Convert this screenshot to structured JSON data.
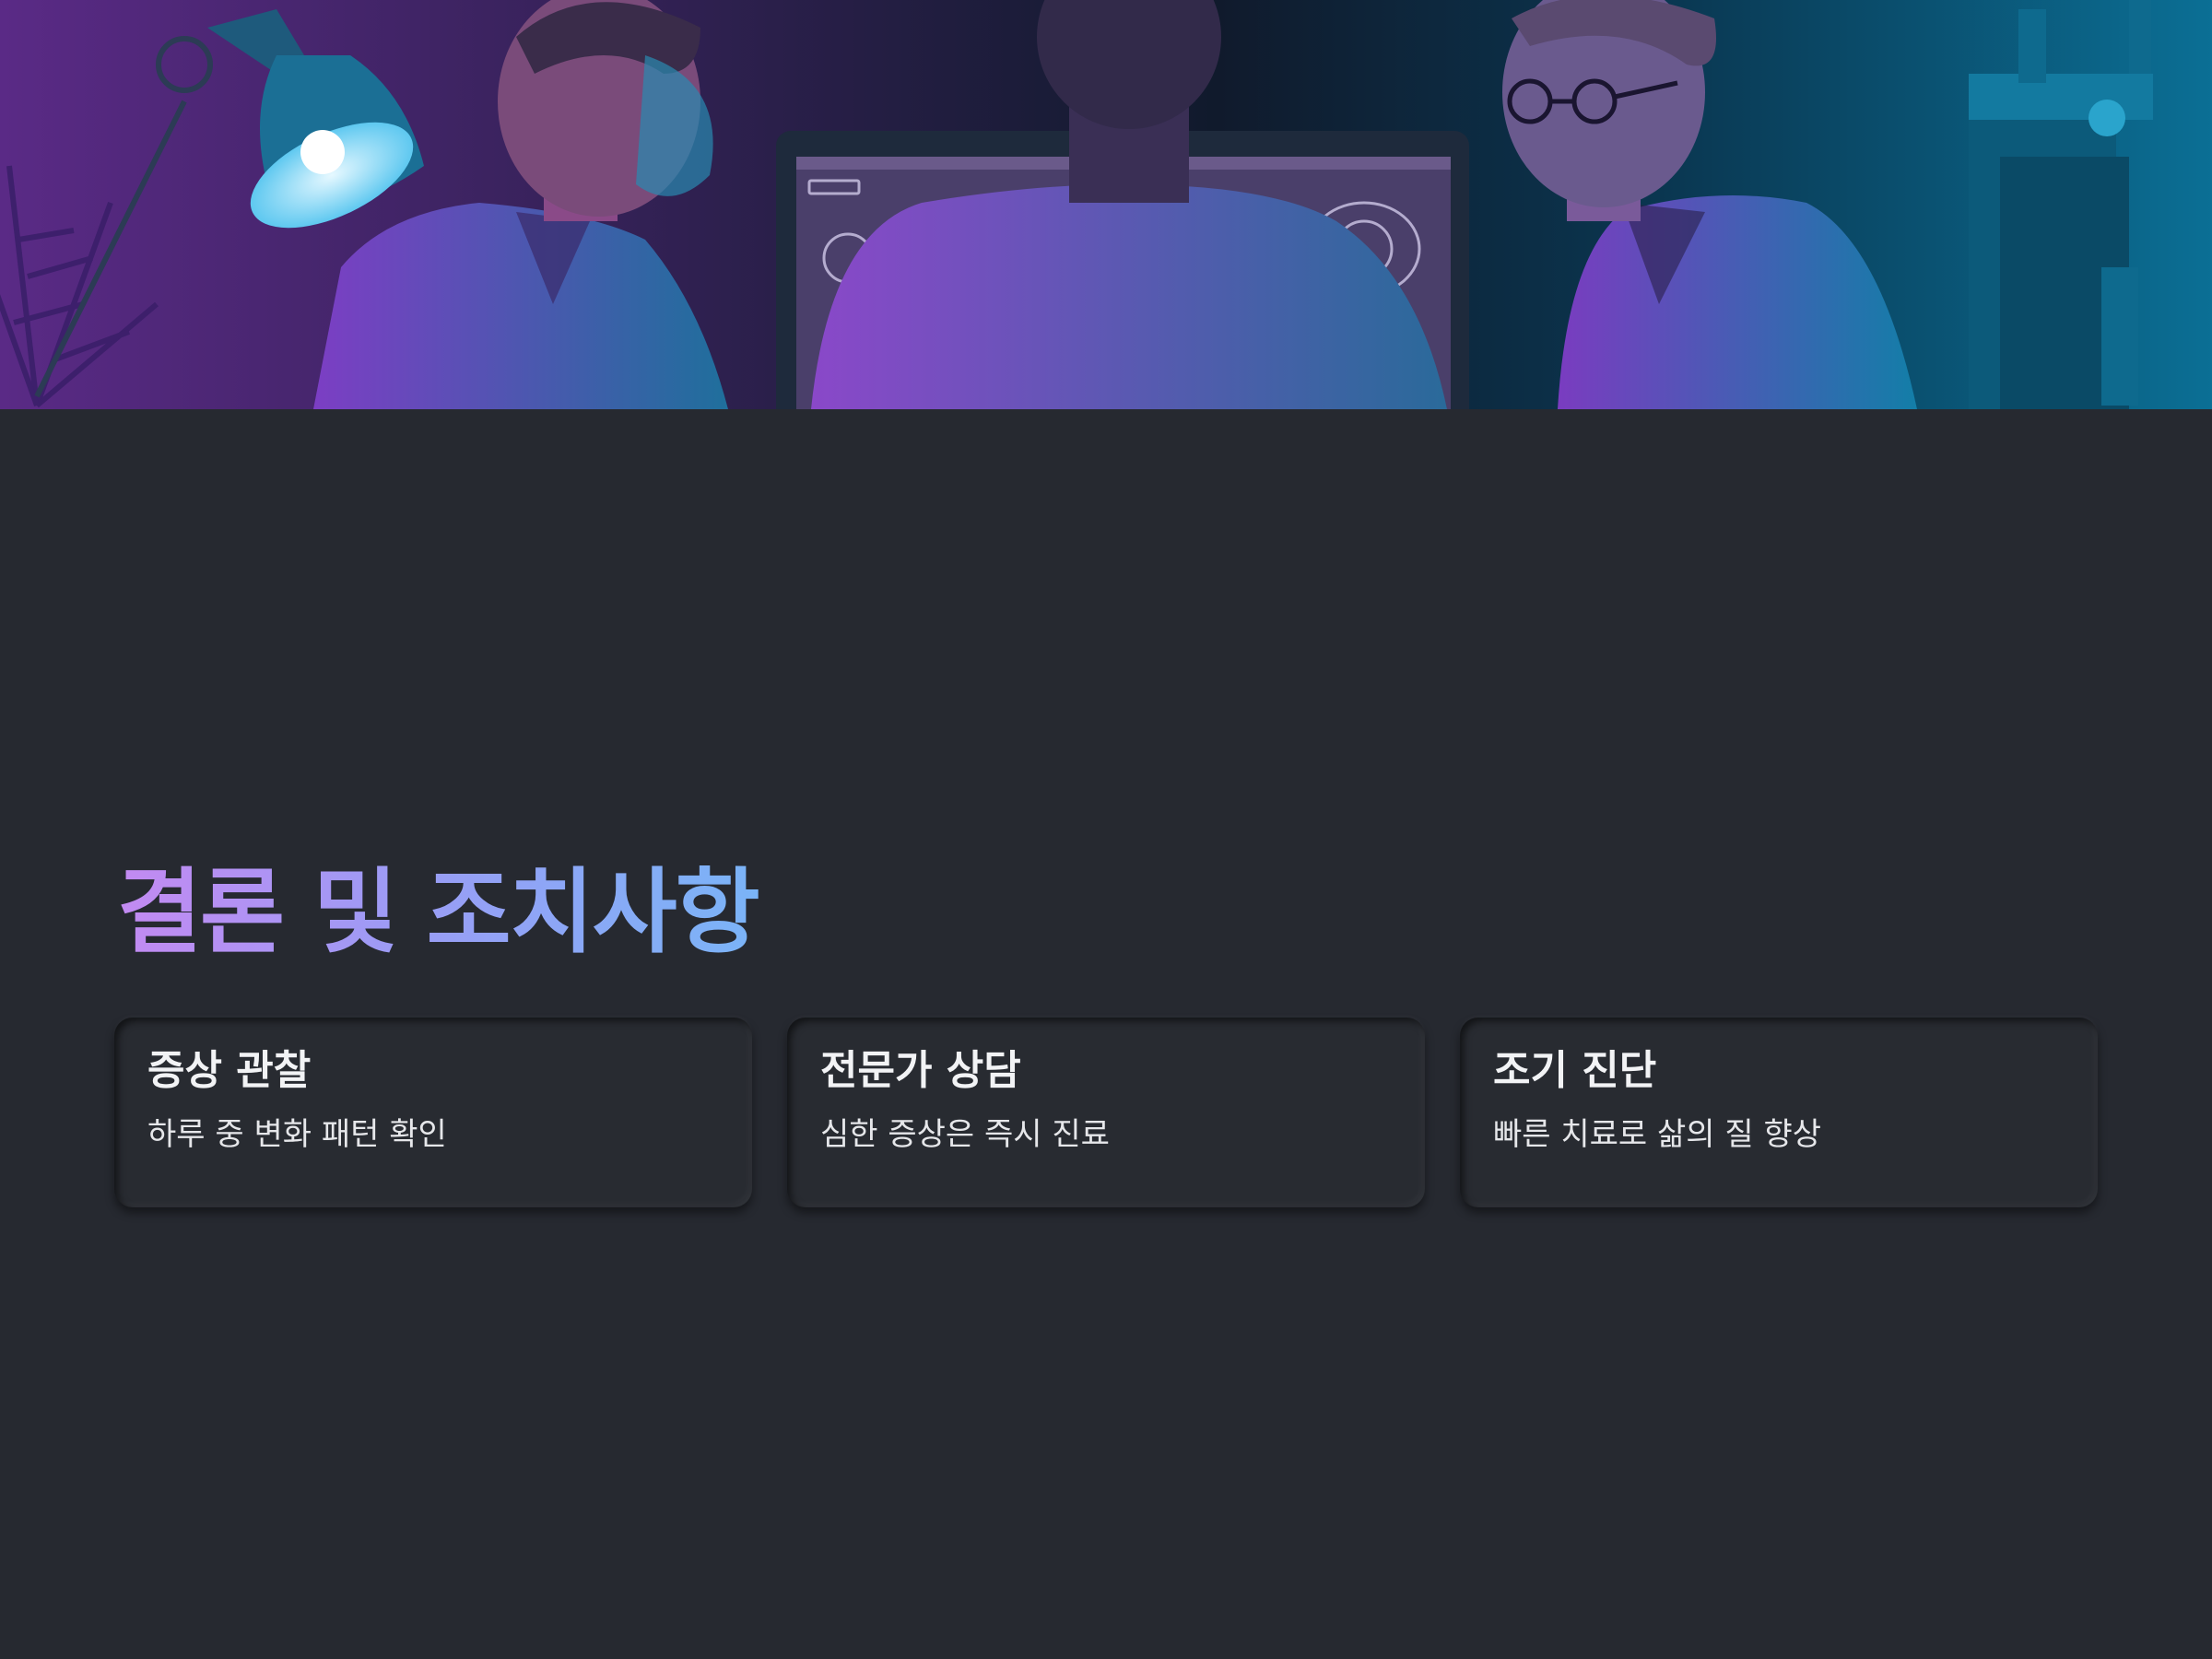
{
  "hero": {
    "image_description": "medical-team-monitor-photo",
    "colors": {
      "left": "#5a2a86",
      "center": "#14213a",
      "right": "#0b6f95"
    }
  },
  "title": "결론 및 조치사항",
  "cards": [
    {
      "title": "증상 관찰",
      "text": "하루 중 변화 패턴 확인"
    },
    {
      "title": "전문가 상담",
      "text": "심한 증상은 즉시 진료"
    },
    {
      "title": "조기 진단",
      "text": "빠른 치료로 삶의 질 향상"
    }
  ],
  "colors": {
    "background": "#262930",
    "card": "#282b31",
    "title_gradient_start": "#c38af2",
    "title_gradient_end": "#7ab4f7",
    "text": "#f2f3f5"
  }
}
